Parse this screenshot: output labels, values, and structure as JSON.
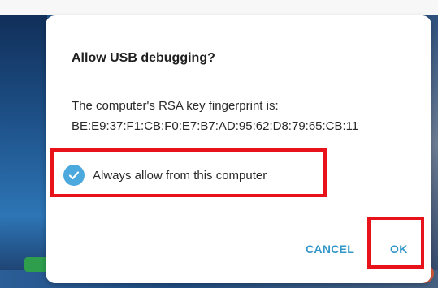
{
  "dialog": {
    "title": "Allow USB debugging?",
    "message_line1": "The computer's RSA key fingerprint is:",
    "message_line2": "BE:E9:37:F1:CB:F0:E7:B7:AD:95:62:D8:79:65:CB:11",
    "checkbox": {
      "label": "Always allow from this computer",
      "checked": true,
      "icon": "checkmark-circle-icon"
    },
    "buttons": {
      "cancel": "CANCEL",
      "ok": "OK"
    }
  },
  "colors": {
    "accent": "#3296c8",
    "checkbox_fill": "#4ba9dd",
    "highlight": "#e8131a"
  }
}
